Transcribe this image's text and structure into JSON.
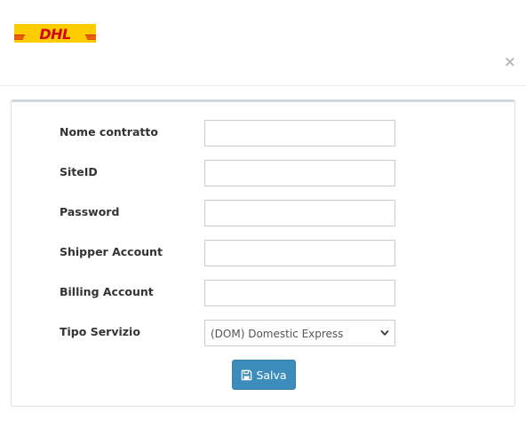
{
  "header": {
    "logo_text": "DHL",
    "close_symbol": "×",
    "brand_colors": {
      "yellow": "#FFCC00",
      "red": "#D40511"
    }
  },
  "form": {
    "fields": [
      {
        "label": "Nome contratto",
        "value": "",
        "placeholder": ""
      },
      {
        "label": "SiteID",
        "value": "",
        "placeholder": ""
      },
      {
        "label": "Password",
        "value": "",
        "placeholder": ""
      },
      {
        "label": "Shipper Account",
        "value": "",
        "placeholder": ""
      },
      {
        "label": "Billing Account",
        "value": "",
        "placeholder": ""
      }
    ],
    "service": {
      "label": "Tipo Servizio",
      "selected": "(DOM) Domestic Express"
    },
    "save_label": "Salva",
    "save_icon": "floppy-disk-icon",
    "button_color": "#3c8dbc"
  }
}
